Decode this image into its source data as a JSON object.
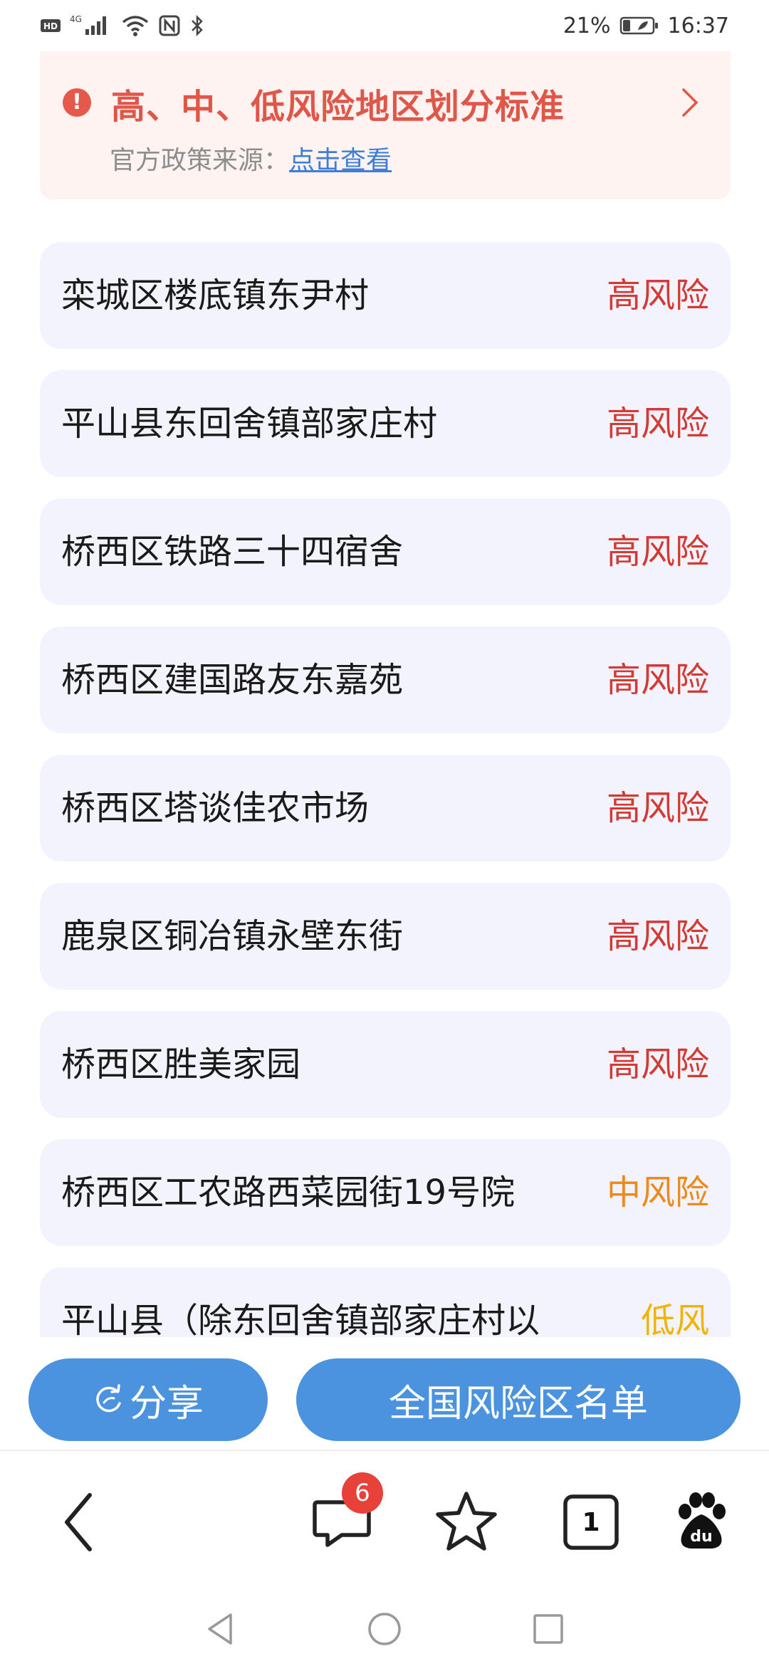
{
  "status_bar": {
    "network_left": "HD",
    "network_type": "4G",
    "battery_percent": "21%",
    "time": "16:37"
  },
  "notice": {
    "title": "高、中、低风险地区划分标准",
    "source_label": "官方政策来源：",
    "source_link": "点击查看"
  },
  "risk_items": [
    {
      "name": "栾城区楼底镇东尹村",
      "level": "高风险",
      "level_key": "high"
    },
    {
      "name": "平山县东回舍镇部家庄村",
      "level": "高风险",
      "level_key": "high"
    },
    {
      "name": "桥西区铁路三十四宿舍",
      "level": "高风险",
      "level_key": "high"
    },
    {
      "name": "桥西区建国路友东嘉苑",
      "level": "高风险",
      "level_key": "high"
    },
    {
      "name": "桥西区塔谈佳农市场",
      "level": "高风险",
      "level_key": "high"
    },
    {
      "name": "鹿泉区铜冶镇永壁东街",
      "level": "高风险",
      "level_key": "high"
    },
    {
      "name": "桥西区胜美家园",
      "level": "高风险",
      "level_key": "high"
    },
    {
      "name": "桥西区工农路西菜园街19号院",
      "level": "中风险",
      "level_key": "medium"
    },
    {
      "name": "平山县（除东回舍镇部家庄村以",
      "level": "低风",
      "level_key": "low"
    }
  ],
  "colors": {
    "high_risk": "#d43a34",
    "medium_risk": "#ec8a1c",
    "low_risk": "#f0b400",
    "button_blue": "#4b93df",
    "notice_red": "#e0574a"
  },
  "actions": {
    "share_label": "分享",
    "risk_list_label": "全国风险区名单"
  },
  "toolbar": {
    "comment_badge": "6",
    "tab_count": "1",
    "icons": [
      "back-icon",
      "comment-icon",
      "star-icon",
      "tabs-icon",
      "baidu-paw-icon"
    ]
  },
  "system_nav": {
    "icons": [
      "nav-back-icon",
      "nav-home-icon",
      "nav-recent-icon"
    ]
  }
}
